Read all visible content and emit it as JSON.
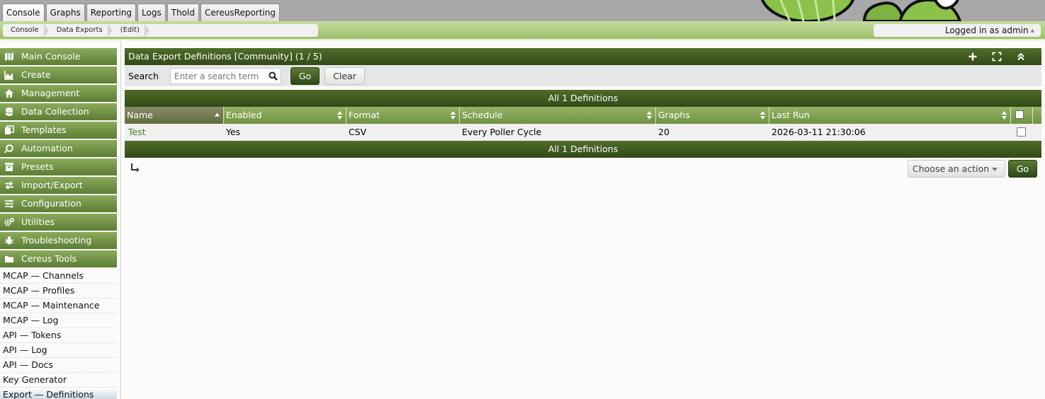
{
  "top_tabs": [
    {
      "label": "Console",
      "active": true
    },
    {
      "label": "Graphs",
      "active": false
    },
    {
      "label": "Reporting",
      "active": false
    },
    {
      "label": "Logs",
      "active": false
    },
    {
      "label": "Thold",
      "active": false
    },
    {
      "label": "CereusReporting",
      "active": false
    }
  ],
  "breadcrumb": [
    "Console",
    "Data Exports",
    "(Edit)"
  ],
  "user": {
    "text": "Logged in as admin",
    "caret_icon": "caret-up-icon"
  },
  "sidebar": {
    "menu": [
      {
        "label": "Main Console",
        "icon": "map-icon"
      },
      {
        "label": "Create",
        "icon": "area-chart-icon"
      },
      {
        "label": "Management",
        "icon": "home-icon"
      },
      {
        "label": "Data Collection",
        "icon": "database-icon"
      },
      {
        "label": "Templates",
        "icon": "copy-icon"
      },
      {
        "label": "Automation",
        "icon": "ring-icon"
      },
      {
        "label": "Presets",
        "icon": "archive-icon"
      },
      {
        "label": "Import/Export",
        "icon": "exchange-icon"
      },
      {
        "label": "Configuration",
        "icon": "sliders-icon"
      },
      {
        "label": "Utilities",
        "icon": "gears-icon"
      },
      {
        "label": "Troubleshooting",
        "icon": "bug-icon"
      },
      {
        "label": "Cereus Tools",
        "icon": "folder-icon"
      }
    ],
    "subitems": [
      {
        "label": "MCAP — Channels",
        "active": false
      },
      {
        "label": "MCAP — Profiles",
        "active": false
      },
      {
        "label": "MCAP — Maintenance",
        "active": false
      },
      {
        "label": "MCAP — Log",
        "active": false
      },
      {
        "label": "API — Tokens",
        "active": false
      },
      {
        "label": "API — Log",
        "active": false
      },
      {
        "label": "API — Docs",
        "active": false
      },
      {
        "label": "Key Generator",
        "active": false
      },
      {
        "label": "Export — Definitions",
        "active": true
      }
    ]
  },
  "panel": {
    "title": "Data Export Definitions [Community] (1 / 5)",
    "icons": [
      "plus-icon",
      "expand-icon",
      "collapse-up-icon"
    ]
  },
  "filter": {
    "search_label": "Search",
    "search_placeholder": "Enter a search term",
    "go_label": "Go",
    "clear_label": "Clear"
  },
  "table": {
    "summary_top": "All 1 Definitions",
    "summary_bottom": "All 1 Definitions",
    "columns": [
      "Name",
      "Enabled",
      "Format",
      "Schedule",
      "Graphs",
      "Last Run"
    ],
    "sorted_column": "Name",
    "rows": [
      {
        "name": "Test",
        "enabled": "Yes",
        "format": "CSV",
        "schedule": "Every Poller Cycle",
        "graphs": "20",
        "last_run": "2026-03-11 21:30:06"
      }
    ]
  },
  "actions": {
    "select_label": "Choose an action",
    "go_label": "Go"
  },
  "colors": {
    "header_dark": "#3d5a1f",
    "menu_green": "#6f9041",
    "link_green": "#4b7a25"
  }
}
